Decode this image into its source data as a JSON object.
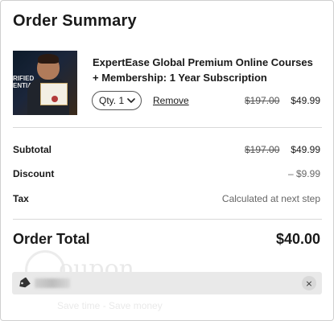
{
  "title": "Order Summary",
  "item": {
    "name": "ExpertEase Global Premium Online Courses + Membership: 1 Year Subscription",
    "image_text": "RIFIED\nENTIALS",
    "qty_label": "Qty. 1",
    "remove_label": "Remove",
    "price_original": "$197.00",
    "price_current": "$49.99"
  },
  "summary": {
    "subtotal_label": "Subtotal",
    "subtotal_original": "$197.00",
    "subtotal_value": "$49.99",
    "discount_label": "Discount",
    "discount_value": "– $9.99",
    "tax_label": "Tax",
    "tax_value": "Calculated at next step"
  },
  "total": {
    "label": "Order Total",
    "value": "$40.00"
  },
  "coupon": {
    "close_symbol": "×"
  },
  "watermark": {
    "text": "oupon",
    "tagline": "Save time - Save money"
  },
  "icons": {
    "tag": "tag-icon",
    "chevron": "chevron-down-icon",
    "close": "close-icon"
  }
}
